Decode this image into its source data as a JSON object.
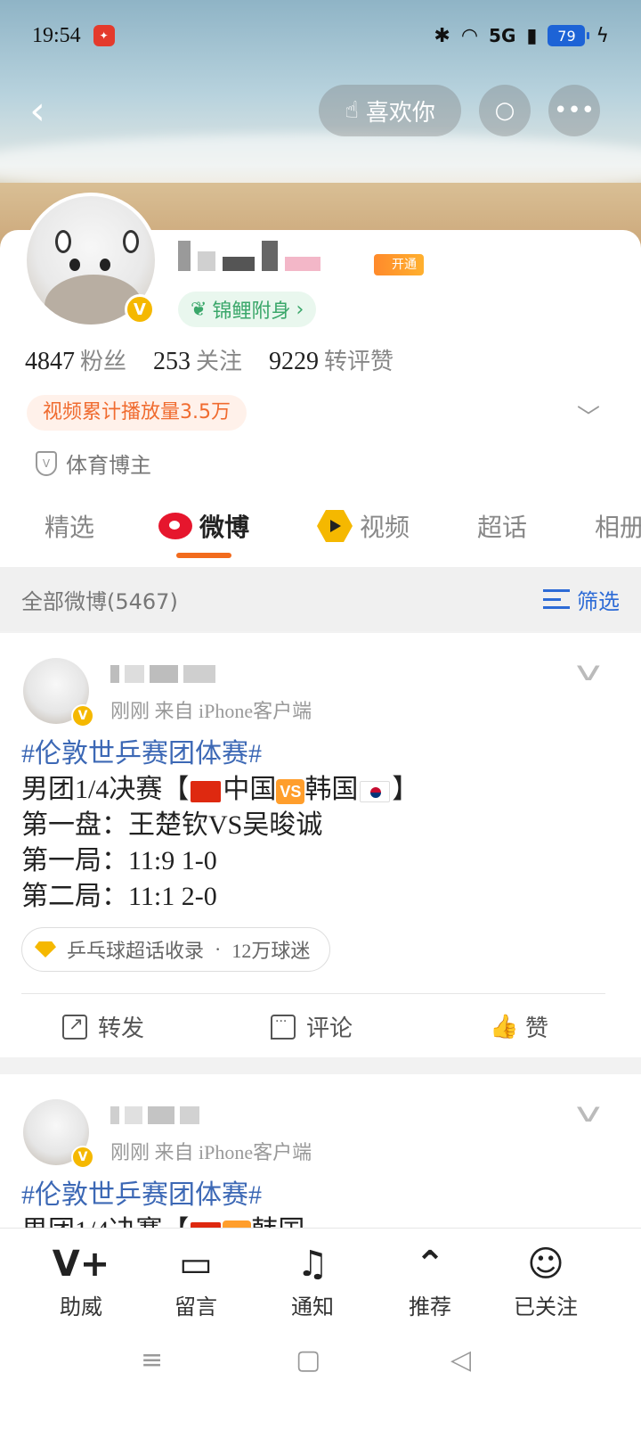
{
  "status_bar": {
    "time": "19:54",
    "network": "5G",
    "battery": "79"
  },
  "top_nav": {
    "like_label": "喜欢你"
  },
  "profile": {
    "kaitong_label": "开通",
    "koi_label": "锦鲤附身",
    "stats": [
      {
        "value": "4847",
        "label": "粉丝"
      },
      {
        "value": "253",
        "label": "关注"
      },
      {
        "value": "9229",
        "label": "转评赞"
      }
    ],
    "play_tag": "视频累计播放量3.5万",
    "category": "体育博主"
  },
  "tabs": [
    {
      "label": "精选",
      "active": false
    },
    {
      "label": "微博",
      "active": true
    },
    {
      "label": "视频",
      "active": false
    },
    {
      "label": "超话",
      "active": false
    },
    {
      "label": "相册",
      "active": false
    }
  ],
  "filter_bar": {
    "left": "全部微博(5467)",
    "filter_label": "筛选"
  },
  "posts": [
    {
      "meta": "刚刚  来自 iPhone客户端",
      "hashtag": "#伦敦世乒赛团体赛#",
      "line1_a": "男团1/4决赛【",
      "line1_cn": "中国",
      "line1_vs": "VS",
      "line1_kr": "韩国",
      "line1_end": "】",
      "line2": "第一盘：王楚钦VS吴晙诚",
      "line3": "第一局：11:9 1-0",
      "line4": "第二局：11:1 2-0",
      "topic": "乒乓球超话收录",
      "topic_count": "12万球迷",
      "actions": {
        "share": "转发",
        "comment": "评论",
        "like": "赞"
      }
    },
    {
      "meta": "刚刚  来自 iPhone客户端",
      "hashtag": "#伦敦世乒赛团体赛#",
      "line1_a": "男团1/4决赛【",
      "line1_kr": "韩国"
    }
  ],
  "bottom_bar": [
    {
      "label": "助威"
    },
    {
      "label": "留言"
    },
    {
      "label": "通知"
    },
    {
      "label": "推荐"
    },
    {
      "label": "已关注"
    }
  ]
}
